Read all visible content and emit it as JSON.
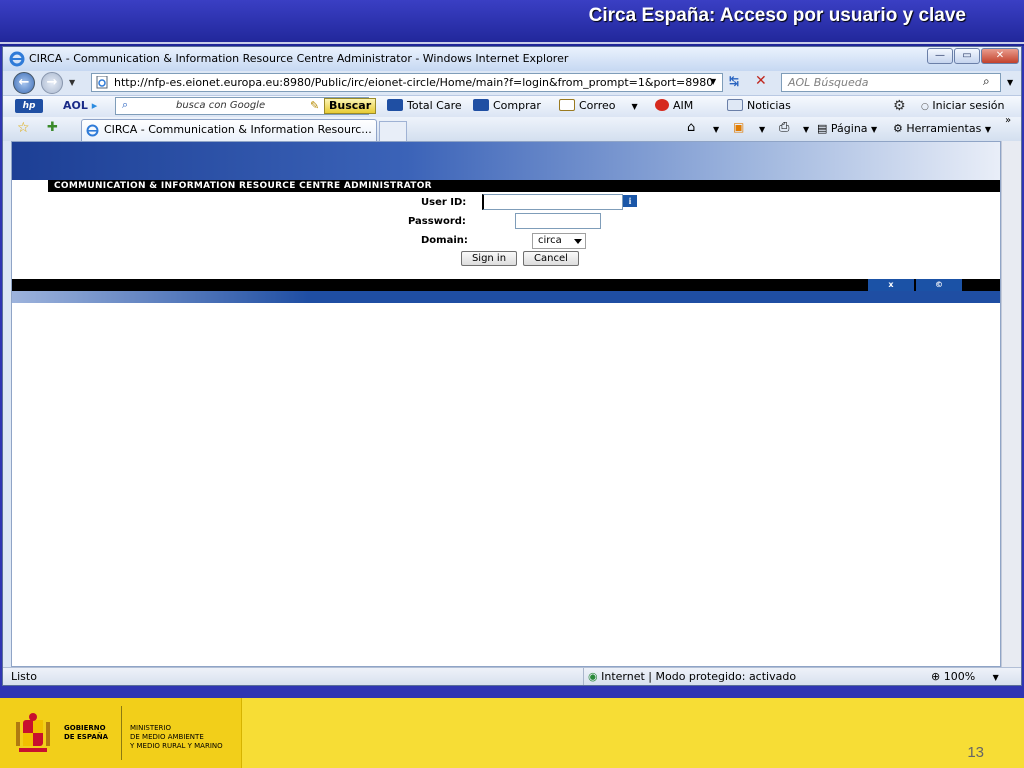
{
  "slide": {
    "title": "Circa España: Acceso por usuario y clave",
    "page_number": "13",
    "footer": {
      "gov_line1": "GOBIERNO",
      "gov_line2": "DE ESPAÑA",
      "min_line1": "MINISTERIO",
      "min_line2": "DE MEDIO AMBIENTE",
      "min_line3": "Y MEDIO RURAL Y MARINO"
    }
  },
  "browser": {
    "window_title": "CIRCA - Communication & Information Resource Centre Administrator - Windows Internet Explorer",
    "address": "http://nfp-es.eionet.europa.eu:8980/Public/irc/eionet-circle/Home/main?f=login&from_prompt=1&port=8980",
    "search_placeholder": "AOL Búsqueda",
    "links": {
      "aol": "AOL",
      "google_placeholder": "busca con Google",
      "buscar": "Buscar",
      "total_care": "Total Care",
      "comprar": "Comprar",
      "correo": "Correo",
      "aim": "AIM",
      "noticias": "Noticias",
      "iniciar_sesion": "Iniciar sesión"
    },
    "tab_title": "CIRCA - Communication & Information Resourc...",
    "commands": {
      "pagina": "Página",
      "herramientas": "Herramientas"
    },
    "status": {
      "left": "Listo",
      "zone": "Internet | Modo protegido: activado",
      "zoom": "100%"
    }
  },
  "app": {
    "header": "COMMUNICATION & INFORMATION RESOURCE CENTRE ADMINISTRATOR",
    "form": {
      "user_id_label": "User ID:",
      "password_label": "Password:",
      "domain_label": "Domain:",
      "domain_value": "circa",
      "info_icon": "i",
      "sign_in": "Sign in",
      "cancel": "Cancel"
    },
    "footer_buttons": {
      "close": "x",
      "about": "©"
    }
  },
  "colors": {
    "slide_blue": "#2f35b3",
    "footer_yellow": "#f7dd35",
    "app_navy": "#1b52a6"
  }
}
